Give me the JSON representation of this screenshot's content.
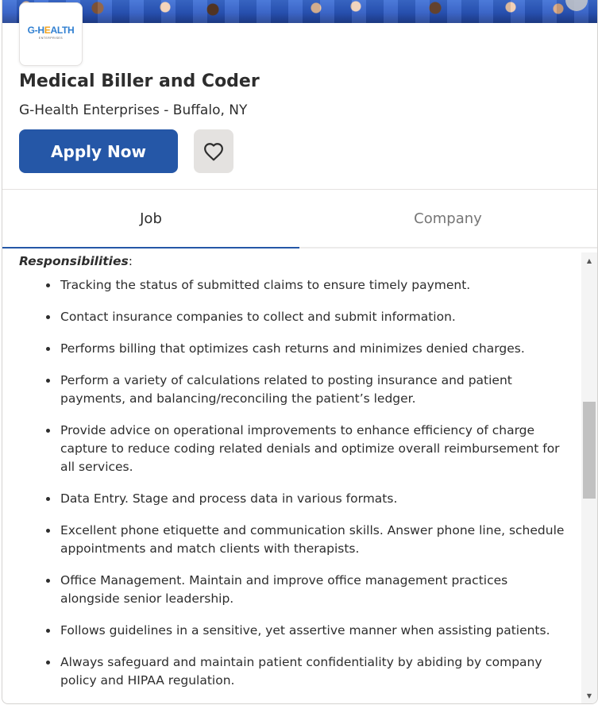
{
  "header": {
    "logo": {
      "brand_pre": "G-",
      "brand_h": "H",
      "brand_e": "E",
      "brand_post": "ALTH",
      "subtitle": "ENTERPRISES"
    },
    "job_title": "Medical Biller and Coder",
    "company_location": "G-Health Enterprises - Buffalo, NY",
    "apply_label": "Apply Now",
    "save_icon": "heart-icon"
  },
  "tabs": [
    {
      "label": "Job",
      "active": true
    },
    {
      "label": "Company",
      "active": false
    }
  ],
  "description": {
    "heading": "Responsibilities",
    "heading_suffix": ":",
    "items": [
      "Tracking the status of submitted claims to ensure timely payment.",
      "Contact insurance companies to collect and submit information.",
      "Performs billing that optimizes cash returns and minimizes denied charges.",
      "Perform a variety of calculations related to posting insurance and patient payments, and balancing/reconciling the patient’s ledger.",
      "Provide advice on operational improvements to enhance efficiency of charge capture to reduce coding related denials and optimize overall reimbursement for all services.",
      "Data Entry. Stage and process data in various formats.",
      "Excellent phone etiquette and communication skills. Answer phone line, schedule appointments and match clients with therapists.",
      "Office Management. Maintain and improve office management practices alongside senior leadership.",
      "Follows guidelines in a sensitive, yet assertive manner when assisting patients.",
      "Always safeguard and maintain patient confidentiality by abiding by company policy and HIPAA regulation."
    ]
  },
  "colors": {
    "primary": "#2557a7",
    "text": "#2d2d2d",
    "muted": "#767676",
    "save_bg": "#e4e2e0"
  },
  "scrollbar": {
    "up_icon": "triangle-up-icon",
    "down_icon": "triangle-down-icon"
  }
}
